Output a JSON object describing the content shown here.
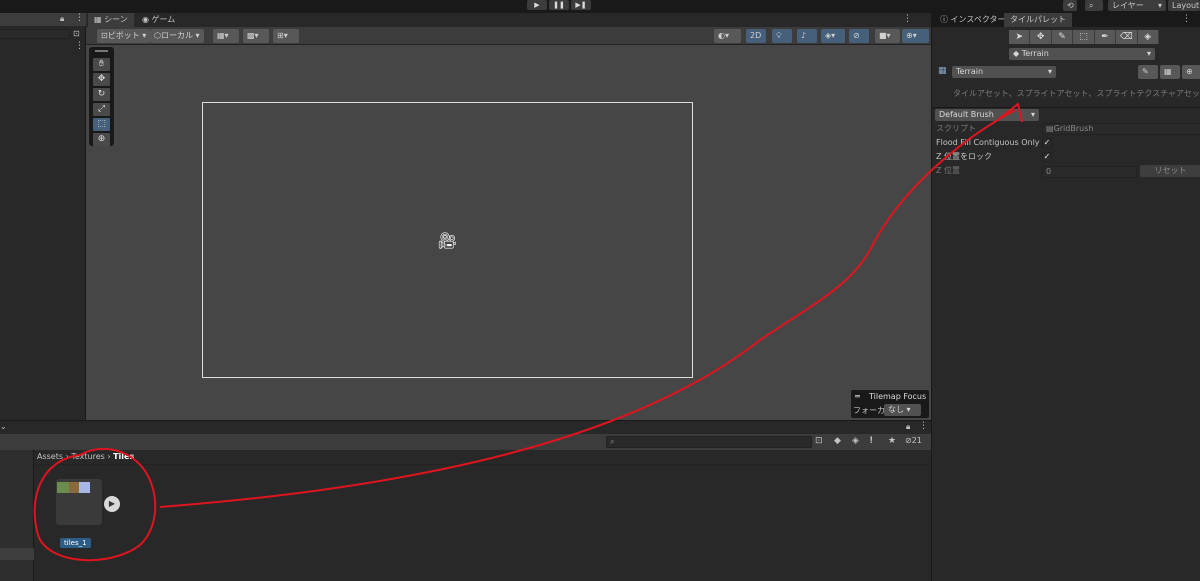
{
  "toolbar": {
    "play_icon": "▶",
    "pause_icon": "❚❚",
    "step_icon": "▶❚",
    "layers_label": "レイヤー",
    "layout_label": "Layout"
  },
  "scene": {
    "tab_scene": "シーン",
    "tab_game": "ゲーム",
    "pivot_label": "ピボット",
    "local_label": "ローカル",
    "mode_2d": "2D",
    "tilemap_focus_title": "Tilemap Focus",
    "focus_label": "フォーカス",
    "focus_value": "なし"
  },
  "inspector": {
    "tab_inspector": "インスペクター",
    "tab_tile_palette": "タイルパレット",
    "tilemap_target": "Terrain",
    "palette_name": "Terrain",
    "drop_hint": "タイルアセット、スプライトアセット、スプライトテクスチャアセットをここにドラッグし",
    "brush_name": "Default Brush",
    "script_label": "スクリプト",
    "script_value": "GridBrush",
    "flood_fill_label": "Flood Fill Contiguous Only",
    "z_lock_label": "Z 位置をロック",
    "z_pos_label": "Z 位置",
    "z_pos_value": "0",
    "reset_label": "リセット",
    "check_mark": "✓"
  },
  "project": {
    "breadcrumb": [
      "Assets",
      "Textures",
      "Tiles"
    ],
    "hidden_count": "21",
    "asset_name": "tiles_1"
  },
  "colors": {
    "accent_blue": "#46607c",
    "annotation_red": "#e0141e",
    "selected_label": "#2c5d87"
  }
}
